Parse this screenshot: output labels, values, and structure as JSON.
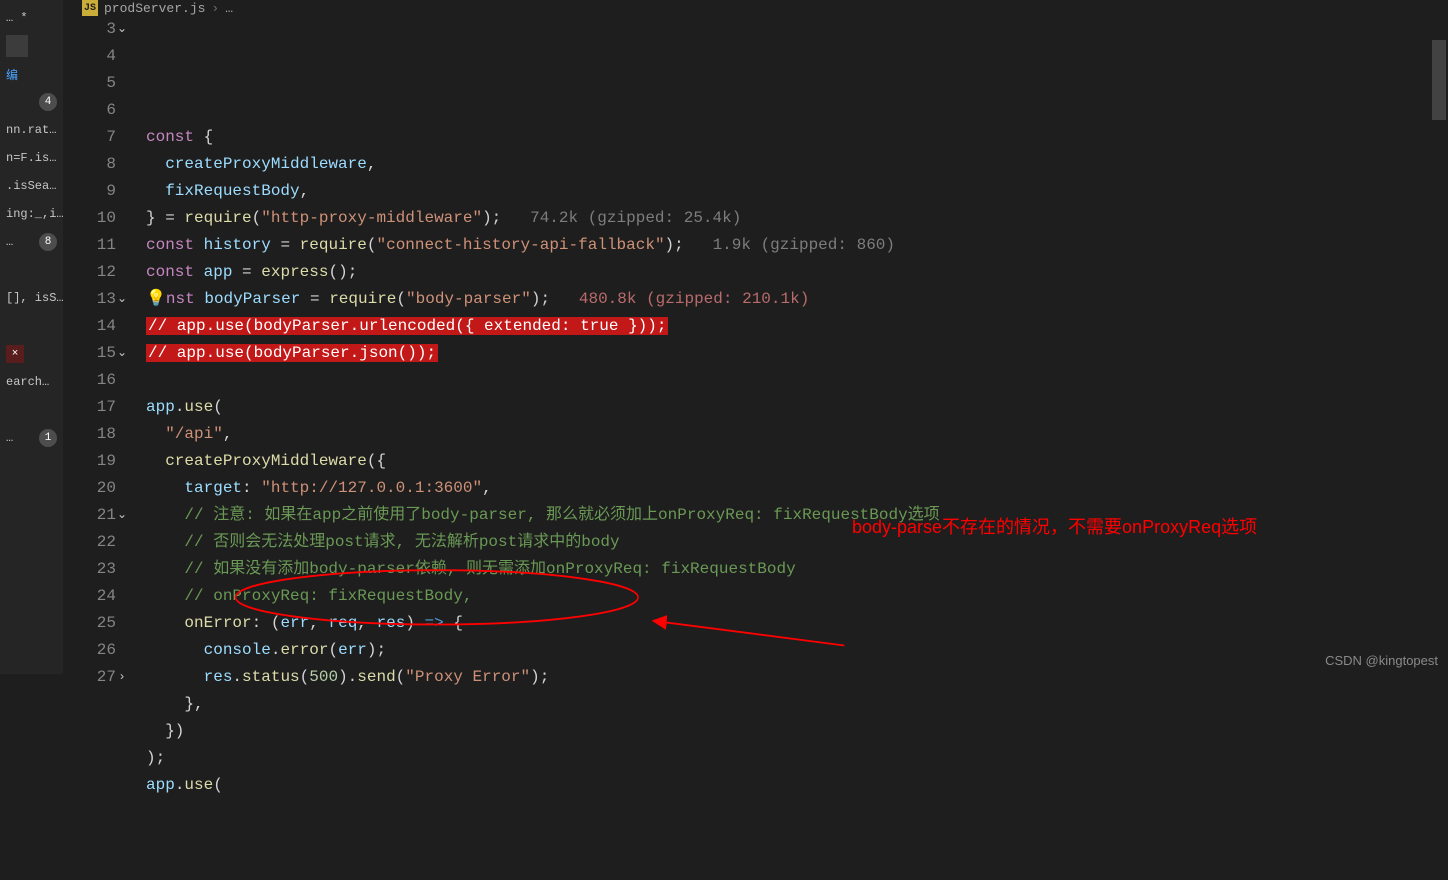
{
  "breadcrumb": {
    "icon": "JS",
    "file": "prodServer.js",
    "sep": "›",
    "rest": "…"
  },
  "sidebar": {
    "items": [
      {
        "label": "… *",
        "name": "open-editor-dirty"
      },
      {
        "label": "",
        "name": "square-placeholder",
        "square": true
      },
      {
        "label": "编",
        "name": "side-cn-edit",
        "blue": true
      },
      {
        "label": "",
        "badge": "4"
      },
      {
        "label": "nn.rat…"
      },
      {
        "label": "n=F.is…"
      },
      {
        "label": ".isSea…"
      },
      {
        "label": "ing:_,i…"
      },
      {
        "label": "…",
        "badge": "8"
      },
      {
        "label": ""
      },
      {
        "label": "[], isS…"
      },
      {
        "label": ""
      },
      {
        "label": "×",
        "close": true
      },
      {
        "label": "earch…"
      },
      {
        "label": ""
      },
      {
        "label": "…",
        "badge": "1"
      }
    ]
  },
  "gutter": {
    "start": 3,
    "end": 27,
    "folds": {
      "3": "v",
      "13": "v",
      "15": "v",
      "21": "v",
      "27": ">"
    }
  },
  "code": {
    "lines": [
      {
        "n": 3,
        "raw": "<kw>const</kw> <p>{</p>"
      },
      {
        "n": 4,
        "raw": "  <var>createProxyMiddleware</var><p>,</p>"
      },
      {
        "n": 5,
        "raw": "  <var>fixRequestBody</var><p>,</p>"
      },
      {
        "n": 6,
        "raw": "<p>} = </p><fn>require</fn><p>(</p><str>\"http-proxy-middleware\"</str><p>);   </p><gz>74.2k (gzipped: 25.4k)</gz>"
      },
      {
        "n": 7,
        "raw": "<kw>const</kw> <var>history</var> <p>=</p> <fn>require</fn><p>(</p><str>\"connect-history-api-fallback\"</str><p>);   </p><gz>1.9k (gzipped: 860)</gz>"
      },
      {
        "n": 8,
        "raw": "<kw>const</kw> <var>app</var> <p>=</p> <fn>express</fn><p>();</p>"
      },
      {
        "n": 9,
        "raw": "<bulb>💡</bulb><kw>nst</kw> <var>bodyParser</var> <p>=</p> <fn>require</fn><p>(</p><str>\"body-parser\"</str><p>);   </p><gz2>480.8k (gzipped: 210.1k)</gz2>"
      },
      {
        "n": 10,
        "raw": "<hl>// app.use(bodyParser.urlencoded({ extended: true }));</hl>"
      },
      {
        "n": 11,
        "raw": "<hl>// app.use(bodyParser.json());</hl>"
      },
      {
        "n": 12,
        "raw": ""
      },
      {
        "n": 13,
        "raw": "<var>app</var><p>.</p><fn>use</fn><p>(</p>"
      },
      {
        "n": 14,
        "raw": "  <str>\"/api\"</str><p>,</p>"
      },
      {
        "n": 15,
        "raw": "  <fn>createProxyMiddleware</fn><p>({</p>"
      },
      {
        "n": 16,
        "raw": "    <var>target</var><p>:</p> <str>\"http://127.0.0.1:3600\"</str><p>,</p>"
      },
      {
        "n": 17,
        "raw": "    <cm>// 注意: 如果在app之前使用了body-parser, 那么就必须加上onProxyReq: fixRequestBody选项</cm>"
      },
      {
        "n": 18,
        "raw": "    <cm>// 否则会无法处理post请求, 无法解析post请求中的body</cm>"
      },
      {
        "n": 19,
        "raw": "    <cm>// 如果没有添加body-parser依赖, 则无需添加onProxyReq: fixRequestBody</cm>"
      },
      {
        "n": 20,
        "raw": "    <cm>// onProxyReq: fixRequestBody,</cm>"
      },
      {
        "n": 21,
        "raw": "    <fn>onError</fn><p>:</p> <p>(</p><var>err</var><p>,</p> <var>req</var><p>,</p> <var>res</var><p>)</p> <blue>=></blue> <p>{</p>"
      },
      {
        "n": 22,
        "raw": "      <var>console</var><p>.</p><fn>error</fn><p>(</p><var>err</var><p>);</p>"
      },
      {
        "n": 23,
        "raw": "      <var>res</var><p>.</p><fn>status</fn><p>(</p><num>500</num><p>).</p><fn>send</fn><p>(</p><str>\"Proxy Error\"</str><p>);</p>"
      },
      {
        "n": 24,
        "raw": "    <p>},</p>"
      },
      {
        "n": 25,
        "raw": "  <p>})</p>"
      },
      {
        "n": 26,
        "raw": "<p>);</p>"
      },
      {
        "n": 27,
        "raw": "<var>app</var><p>.</p><fn>use</fn><p>(</p>"
      }
    ]
  },
  "annotation": {
    "text": "body-parse不存在的情况，不需要onProxyReq选项"
  },
  "watermark": "CSDN @kingtopest"
}
